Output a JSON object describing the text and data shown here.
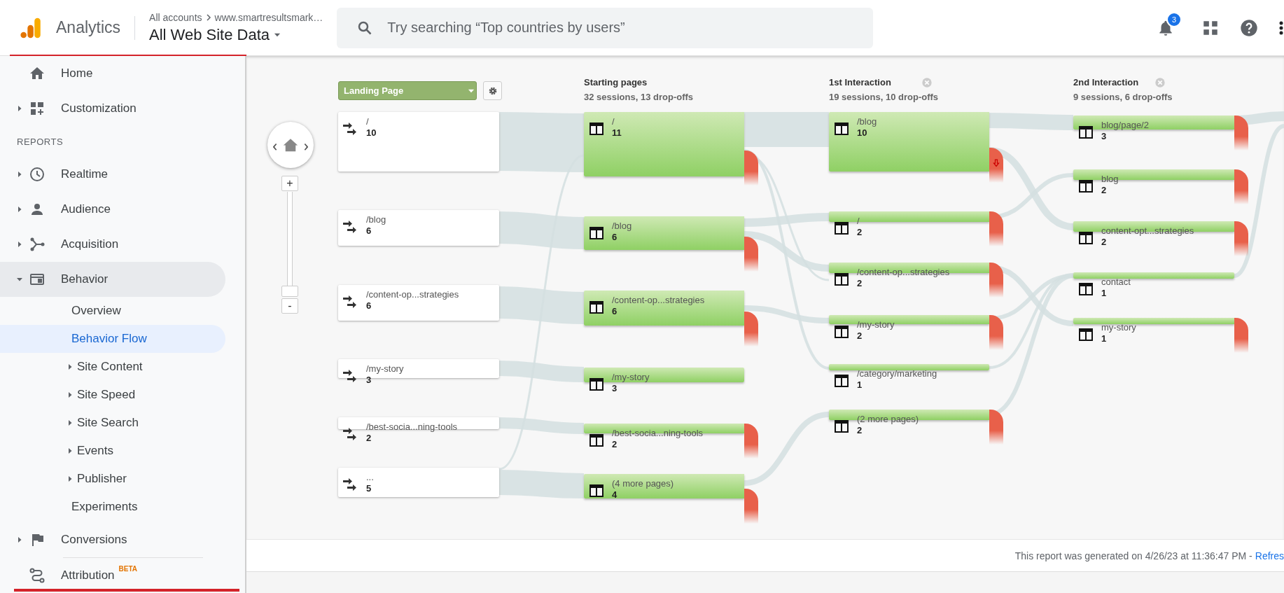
{
  "header": {
    "product": "Analytics",
    "breadcrumb": [
      "All accounts",
      "www.smartresultsmark…"
    ],
    "view": "All Web Site Data",
    "search": {
      "placeholder": "Try searching “Top countries by users”"
    },
    "notifications": "3"
  },
  "sidebar": {
    "items": [
      {
        "kind": "link",
        "label": "Home",
        "selected": false
      },
      {
        "kind": "group",
        "label": "Customization",
        "expanded": false,
        "selected": false
      },
      {
        "kind": "section",
        "label": "REPORTS"
      },
      {
        "kind": "group",
        "label": "Realtime",
        "expanded": false,
        "selected": false
      },
      {
        "kind": "group",
        "label": "Audience",
        "expanded": false,
        "selected": false
      },
      {
        "kind": "group",
        "label": "Acquisition",
        "expanded": false,
        "selected": false
      },
      {
        "kind": "group",
        "label": "Behavior",
        "expanded": true,
        "selected": false,
        "children": [
          {
            "kind": "link",
            "label": "Overview",
            "selected": false
          },
          {
            "kind": "link",
            "label": "Behavior Flow",
            "selected": true
          },
          {
            "kind": "group",
            "label": "Site Content",
            "expanded": false,
            "selected": false
          },
          {
            "kind": "group",
            "label": "Site Speed",
            "expanded": false,
            "selected": false
          },
          {
            "kind": "group",
            "label": "Site Search",
            "expanded": false,
            "selected": false
          },
          {
            "kind": "group",
            "label": "Events",
            "expanded": false,
            "selected": false
          },
          {
            "kind": "group",
            "label": "Publisher",
            "expanded": false,
            "selected": false
          },
          {
            "kind": "link",
            "label": "Experiments",
            "selected": false
          }
        ]
      },
      {
        "kind": "group",
        "label": "Conversions",
        "expanded": false,
        "selected": false
      },
      {
        "kind": "link",
        "label": "Attribution",
        "badge": "BETA",
        "selected": false
      }
    ]
  },
  "flow": {
    "dimension": "Landing Page",
    "zoom": {
      "in": "+",
      "out": "-",
      "level": 0
    },
    "landing": [
      {
        "label": "/",
        "count": "10"
      },
      {
        "label": "/blog",
        "count": "6"
      },
      {
        "label": "/content-op...strategies",
        "count": "6"
      },
      {
        "label": "/my-story",
        "count": "3"
      },
      {
        "label": "/best-socia...ning-tools",
        "count": "2"
      },
      {
        "label": "...",
        "count": "5"
      }
    ],
    "columns": [
      {
        "title": "Starting pages",
        "summary": "32 sessions, 13 drop-offs",
        "closable": false,
        "nodes": [
          {
            "label": "/",
            "count": "11",
            "dropoff": true,
            "flagged": false
          },
          {
            "label": "/blog",
            "count": "6",
            "dropoff": true,
            "flagged": false
          },
          {
            "label": "/content-op...strategies",
            "count": "6",
            "dropoff": true,
            "flagged": false
          },
          {
            "label": "/my-story",
            "count": "3",
            "dropoff": false,
            "flagged": false
          },
          {
            "label": "/best-socia...ning-tools",
            "count": "2",
            "dropoff": true,
            "flagged": false
          },
          {
            "label": "(4 more pages)",
            "count": "4",
            "dropoff": true,
            "flagged": false
          }
        ]
      },
      {
        "title": "1st Interaction",
        "summary": "19 sessions, 10 drop-offs",
        "closable": true,
        "nodes": [
          {
            "label": "/blog",
            "count": "10",
            "dropoff": true,
            "flagged": true
          },
          {
            "label": "/",
            "count": "2",
            "dropoff": true,
            "flagged": false
          },
          {
            "label": "/content-op...strategies",
            "count": "2",
            "dropoff": true,
            "flagged": false
          },
          {
            "label": "/my-story",
            "count": "2",
            "dropoff": true,
            "flagged": false
          },
          {
            "label": "/category/marketing",
            "count": "1",
            "dropoff": false,
            "flagged": false
          },
          {
            "label": "(2 more pages)",
            "count": "2",
            "dropoff": true,
            "flagged": false
          }
        ]
      },
      {
        "title": "2nd Interaction",
        "summary": "9 sessions, 6 drop-offs",
        "closable": true,
        "nodes": [
          {
            "label": "blog/page/2",
            "count": "3",
            "dropoff": true,
            "flagged": false
          },
          {
            "label": "blog",
            "count": "2",
            "dropoff": true,
            "flagged": false
          },
          {
            "label": "content-opt...strategies",
            "count": "2",
            "dropoff": true,
            "flagged": false
          },
          {
            "label": "contact",
            "count": "1",
            "dropoff": false,
            "flagged": false
          },
          {
            "label": "my-story",
            "count": "1",
            "dropoff": true,
            "flagged": false
          }
        ]
      }
    ]
  },
  "footer": {
    "text": "This report was generated on 4/26/23 at 11:36:47 PM -",
    "link": "Refres"
  }
}
